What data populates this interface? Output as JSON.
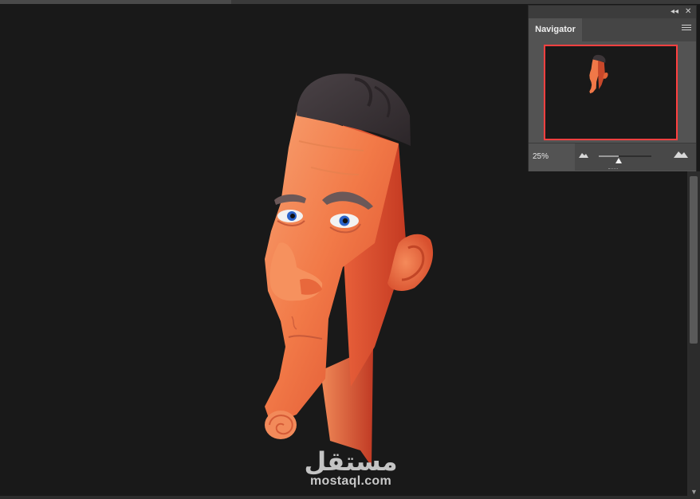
{
  "navigator": {
    "tab_label": "Navigator",
    "zoom_value": "25%",
    "zoom_slider_fraction": 0.38,
    "frame_color": "#ff4040"
  },
  "panel_controls": {
    "collapse_glyph": "◂◂",
    "close_glyph": "✕",
    "menu_icon": "panel-menu-icon"
  },
  "watermark": {
    "arabic": "مستقل",
    "latin": "mostaql.com"
  },
  "colors": {
    "canvas": "#191919",
    "panel": "#535353",
    "skin": "#f07848",
    "hair": "#3c3538"
  }
}
